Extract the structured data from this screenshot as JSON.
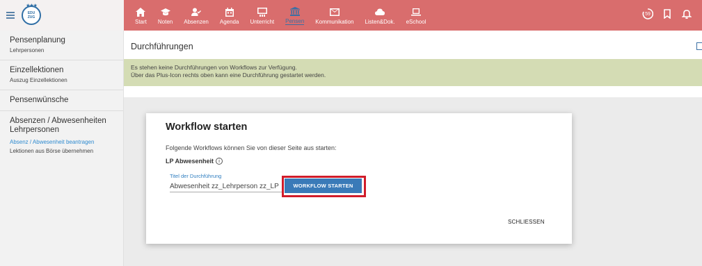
{
  "logo": {
    "text_top": "EDU",
    "text_bottom": "ZUG"
  },
  "nav": {
    "items": [
      {
        "label": "Start",
        "icon": "home-icon"
      },
      {
        "label": "Noten",
        "icon": "graduation-cap-icon"
      },
      {
        "label": "Absenzen",
        "icon": "person-check-icon"
      },
      {
        "label": "Agenda",
        "icon": "calendar-icon"
      },
      {
        "label": "Unterricht",
        "icon": "board-icon"
      },
      {
        "label": "Pensen",
        "icon": "institution-icon",
        "active": true
      },
      {
        "label": "Kommunikation",
        "icon": "mail-icon"
      },
      {
        "label": "Listen&Dok.",
        "icon": "cloud-icon"
      },
      {
        "label": "eSchool",
        "icon": "laptop-icon"
      }
    ]
  },
  "topright": {
    "badge": "59"
  },
  "sidebar": {
    "groups": [
      {
        "title": "Pensenplanung",
        "items": [
          "Lehrpersonen"
        ]
      },
      {
        "title": "Einzellektionen",
        "items": [
          "Auszug Einzellektionen"
        ]
      },
      {
        "title": "Pensenwünsche",
        "items": []
      },
      {
        "title": "Absenzen / Abwesenheiten Lehrpersonen",
        "items": [
          "Absenz / Abwesenheit beantragen",
          "Lektionen aus Börse übernehmen"
        ]
      }
    ]
  },
  "main": {
    "title": "Durchführungen",
    "banner_line1": "Es stehen keine Durchführungen von Workflows zur Verfügung.",
    "banner_line2": "Über das Plus-Icon rechts oben kann eine Durchführung gestartet werden."
  },
  "dialog": {
    "title": "Workflow starten",
    "intro": "Folgende Workflows können Sie von dieser Seite aus starten:",
    "workflow_name": "LP Abwesenheit",
    "field_label": "Titel der Durchführung",
    "field_value": "Abwesenheit zz_Lehrperson zz_LP",
    "start_button": "WORKFLOW STARTEN",
    "close_button": "SCHLIESSEN"
  },
  "colors": {
    "topbar": "#d96d6d",
    "banner": "#d4dcb4",
    "primary_button": "#3a7ab8",
    "highlight": "#d01c2a",
    "active_link": "#2f8bd0"
  }
}
